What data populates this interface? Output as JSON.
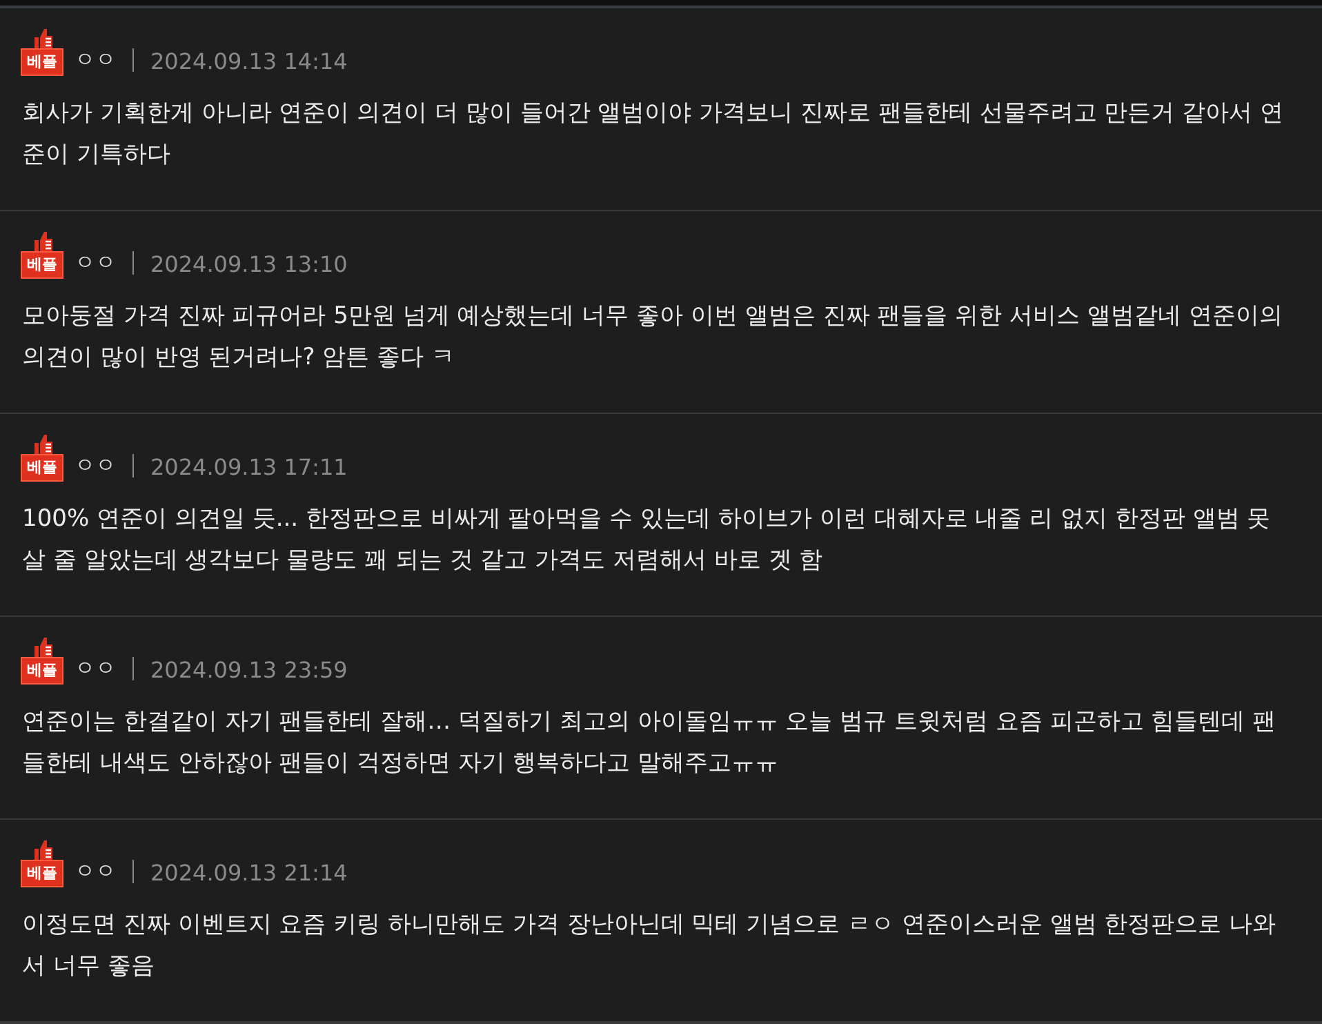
{
  "comments": [
    {
      "badge": "베플",
      "author": "ㅇㅇ",
      "date": "2024.09.13 14:14",
      "body": "회사가 기획한게 아니라 연준이 의견이 더 많이 들어간 앨범이야 가격보니 진짜로 팬들한테 선물주려고 만든거 같아서 연준이 기특하다"
    },
    {
      "badge": "베플",
      "author": "ㅇㅇ",
      "date": "2024.09.13 13:10",
      "body": "모아둥절 가격 진짜 피규어라 5만원 넘게 예상했는데 너무 좋아 이번 앨범은 진짜 팬들을 위한 서비스 앨범같네 연준이의 의견이 많이 반영 된거려나? 암튼 좋다 ㅋ"
    },
    {
      "badge": "베플",
      "author": "ㅇㅇ",
      "date": "2024.09.13 17:11",
      "body": "100% 연준이 의견일 듯... 한정판으로 비싸게 팔아먹을 수 있는데 하이브가 이런 대혜자로 내줄 리 없지 한정판 앨범 못 살 줄 알았는데 생각보다 물량도 꽤 되는 것 같고 가격도 저렴해서 바로 겟 함"
    },
    {
      "badge": "베플",
      "author": "ㅇㅇ",
      "date": "2024.09.13 23:59",
      "body": "연준이는 한결같이 자기 팬들한테 잘해… 덕질하기 최고의 아이돌임ㅠㅠ 오늘 범규 트윗처럼 요즘 피곤하고 힘들텐데 팬들한테 내색도 안하잖아 팬들이 걱정하면 자기 행복하다고 말해주고ㅠㅠ"
    },
    {
      "badge": "베플",
      "author": "ㅇㅇ",
      "date": "2024.09.13 21:14",
      "body": "이정도면 진짜 이벤트지 요즘 키링 하니만해도 가격 장난아닌데 믹테 기념으로 ㄹㅇ 연준이스러운 앨범 한정판으로 나와서 너무 좋음"
    }
  ]
}
